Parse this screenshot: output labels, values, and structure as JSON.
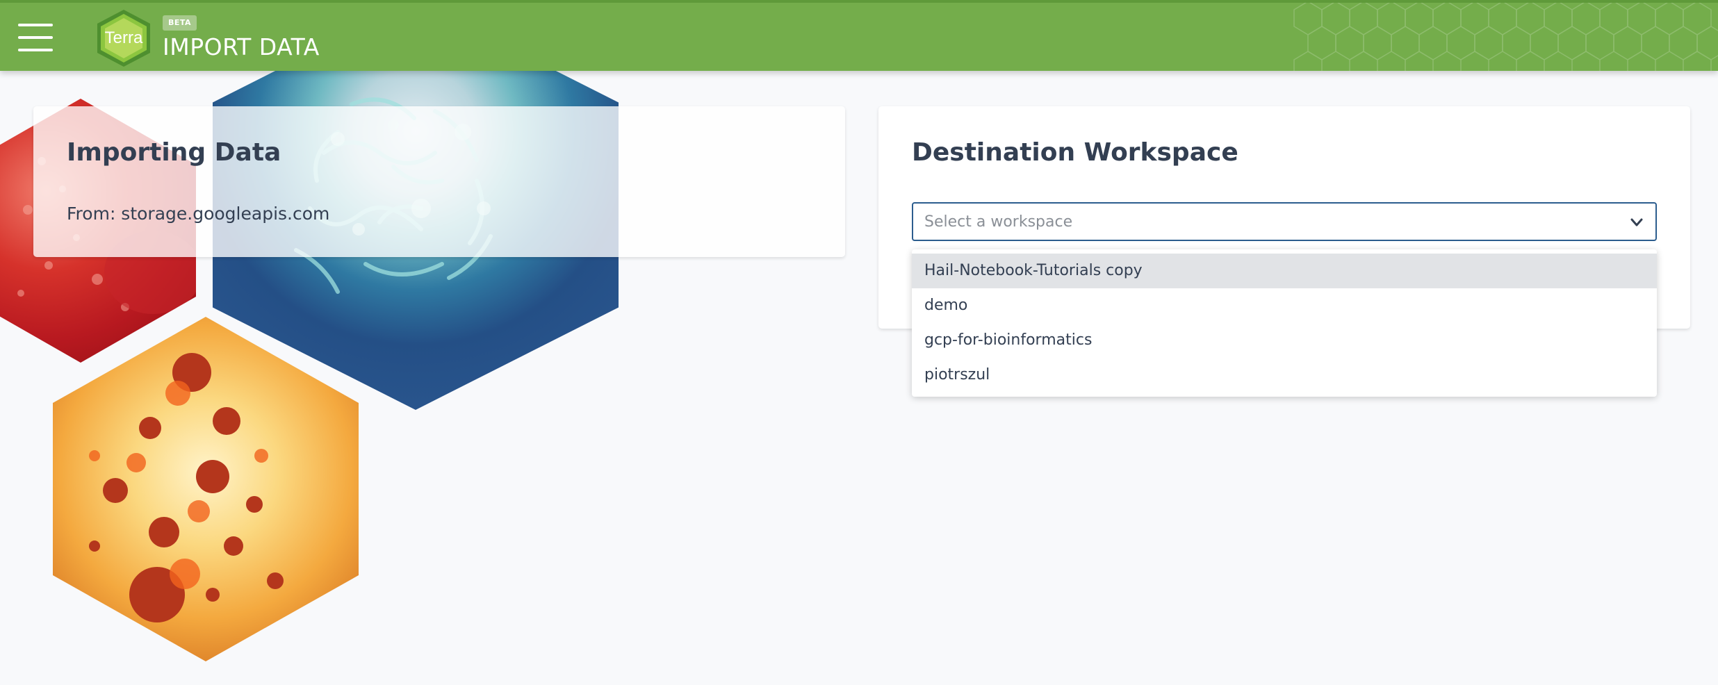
{
  "header": {
    "menu_icon": "hamburger-icon",
    "logo_text": "Terra",
    "beta_label": "BETA",
    "title": "IMPORT DATA",
    "color": "#74ad4b"
  },
  "import_card": {
    "title": "Importing Data",
    "from_text": "From: storage.googleapis.com"
  },
  "destination_card": {
    "title": "Destination Workspace",
    "select_placeholder": "Select a workspace",
    "chevron_icon": "chevron-down-icon"
  },
  "dropdown": {
    "options": [
      "Hail-Notebook-Tutorials copy",
      "demo",
      "gcp-for-bioinformatics",
      "piotrszul"
    ],
    "highlighted_index": 0
  }
}
